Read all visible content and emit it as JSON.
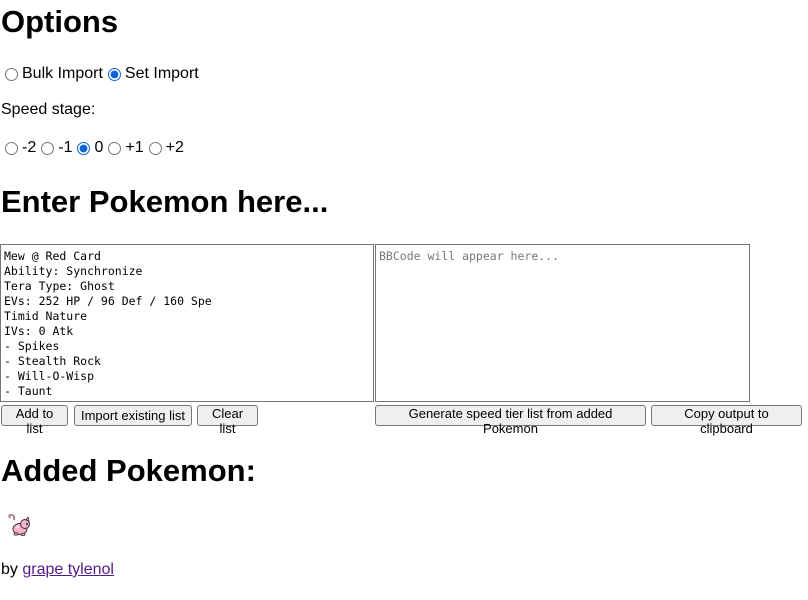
{
  "options": {
    "title": "Options",
    "import_mode": {
      "options": [
        "Bulk Import",
        "Set Import"
      ],
      "selected": "Set Import"
    },
    "speed_stage": {
      "label": "Speed stage:",
      "options": [
        "-2",
        "-1",
        "0",
        "+1",
        "+2"
      ],
      "selected": "0"
    }
  },
  "entry": {
    "title": "Enter Pokemon here...",
    "input_text": "Mew @ Red Card\nAbility: Synchronize\nTera Type: Ghost\nEVs: 252 HP / 96 Def / 160 Spe\nTimid Nature\nIVs: 0 Atk\n- Spikes\n- Stealth Rock\n- Will-O-Wisp\n- Taunt",
    "output_placeholder": "BBCode will appear here...",
    "buttons": {
      "add": "Add to list",
      "import": "Import existing list",
      "clear": "Clear list",
      "generate": "Generate speed tier list from added Pokemon",
      "copy": "Copy output to clipboard"
    }
  },
  "added": {
    "title": "Added Pokemon:",
    "items": [
      {
        "icon": "mew-sprite-icon"
      }
    ]
  },
  "footer": {
    "prefix": "by",
    "author": "grape tylenol"
  }
}
